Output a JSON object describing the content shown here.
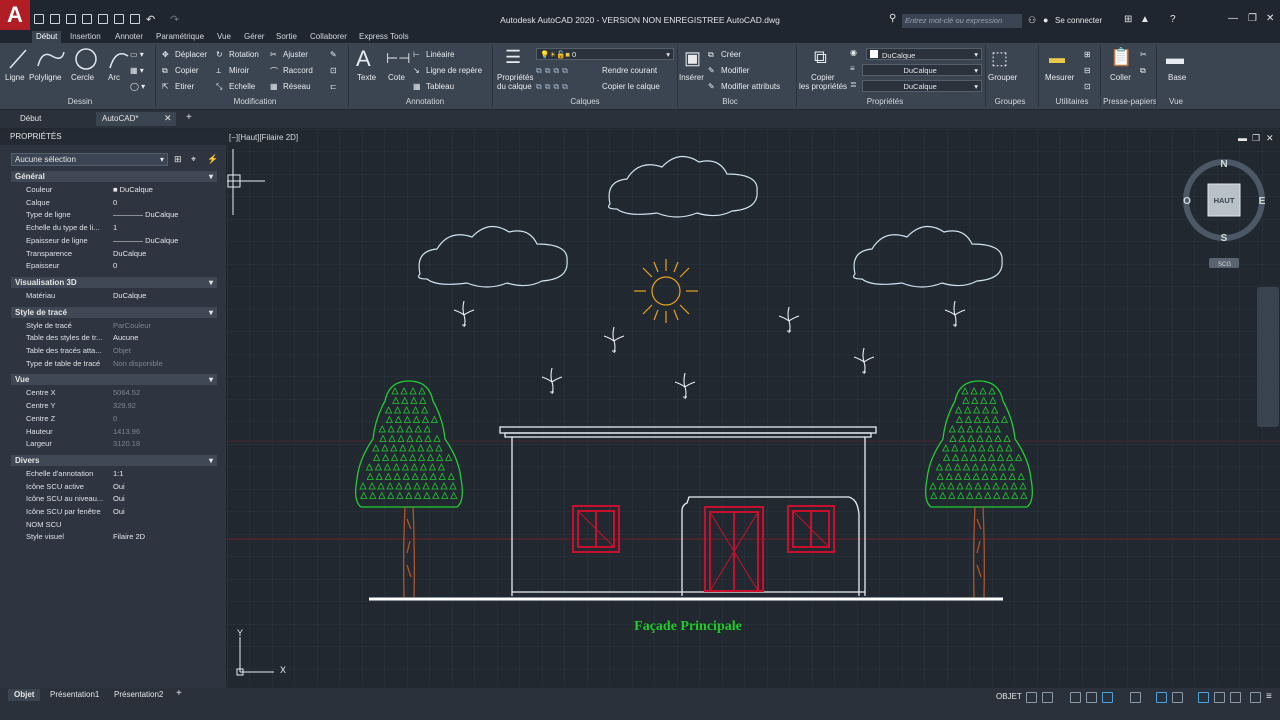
{
  "app": {
    "title": "Autodesk AutoCAD 2020 - VERSION NON ENREGISTREE   AutoCAD.dwg",
    "logo_letter": "A",
    "search_placeholder": "Entrez mot-clé ou expression",
    "signin": "Se connecter"
  },
  "ribbon_tabs": [
    "Début",
    "Insertion",
    "Annoter",
    "Paramétrique",
    "Vue",
    "Gérer",
    "Sortie",
    "Collaborer",
    "Express Tools"
  ],
  "draw": {
    "line": "Ligne",
    "polyline": "Polyligne",
    "circle": "Cercle",
    "arc": "Arc",
    "panel": "Dessin"
  },
  "modify": {
    "move": "Déplacer",
    "rotate": "Rotation",
    "trim": "Ajuster",
    "copy": "Copier",
    "mirror": "Miroir",
    "fillet": "Raccord",
    "stretch": "Etirer",
    "scale": "Echelle",
    "array": "Réseau",
    "panel": "Modification"
  },
  "annotation": {
    "text": "Texte",
    "dim": "Cote",
    "linear": "Linéaire",
    "leader": "Ligne de repère",
    "table": "Tableau",
    "panel": "Annotation"
  },
  "layers": {
    "props1": "Propriétés",
    "props2": "du calque",
    "current": "0",
    "make_current": "Rendre courant",
    "copy_layer": "Copier le calque",
    "panel": "Calques"
  },
  "block": {
    "insert": "Insérer",
    "create": "Créer",
    "edit": "Modifier",
    "edit_attr": "Modifier attributs",
    "panel": "Bloc"
  },
  "properties": {
    "copy1": "Copier",
    "copy2": "les propriétés",
    "color": "DuCalque",
    "linetype": "DuCalque",
    "lineweight": "DuCalque",
    "panel": "Propriétés"
  },
  "groups": {
    "group": "Grouper",
    "panel": "Groupes"
  },
  "utilities": {
    "measure": "Mesurer",
    "panel": "Utilitaires"
  },
  "clipboard": {
    "paste": "Coller",
    "panel": "Presse-papiers"
  },
  "view": {
    "base": "Base",
    "panel": "Vue"
  },
  "doc_tabs": [
    "Début",
    "AutoCAD*"
  ],
  "palette": {
    "title": "PROPRIÉTÉS",
    "selection": "Aucune sélection",
    "sections": [
      {
        "name": "Général",
        "rows": [
          [
            "Couleur",
            "■ DuCalque"
          ],
          [
            "Calque",
            "0"
          ],
          [
            "Type de ligne",
            "———— DuCalque"
          ],
          [
            "Echelle du type de li...",
            "1"
          ],
          [
            "Epaisseur de ligne",
            "———— DuCalque"
          ],
          [
            "Transparence",
            "DuCalque"
          ],
          [
            "Epaisseur",
            "0"
          ]
        ]
      },
      {
        "name": "Visualisation 3D",
        "rows": [
          [
            "Matériau",
            "DuCalque"
          ]
        ]
      },
      {
        "name": "Style de tracé",
        "rows": [
          [
            "Style de tracé",
            "ParCouleur"
          ],
          [
            "Table des styles de tr...",
            "Aucune"
          ],
          [
            "Table des tracés atta...",
            "Objet"
          ],
          [
            "Type de table de tracé",
            "Non disponible"
          ]
        ]
      },
      {
        "name": "Vue",
        "rows": [
          [
            "Centre X",
            "5064.52"
          ],
          [
            "Centre Y",
            "329.92"
          ],
          [
            "Centre Z",
            "0"
          ],
          [
            "Hauteur",
            "1413.96"
          ],
          [
            "Largeur",
            "3120.18"
          ]
        ]
      },
      {
        "name": "Divers",
        "rows": [
          [
            "Echelle d'annotation",
            "1:1"
          ],
          [
            "Icône SCU active",
            "Oui"
          ],
          [
            "Icône SCU au niveau...",
            "Oui"
          ],
          [
            "Icône SCU par fenêtre",
            "Oui"
          ],
          [
            "NOM SCU",
            ""
          ],
          [
            "Style visuel",
            "Filaire 2D"
          ]
        ]
      }
    ]
  },
  "viewport": {
    "label": "[−][Haut][Filaire 2D]",
    "drawing_title": "Façade Principale",
    "viewcube": {
      "top": "HAUT",
      "n": "N",
      "s": "S",
      "e": "E",
      "w": "O",
      "ucs": "SCG"
    },
    "ucs_x": "X",
    "ucs_y": "Y"
  },
  "layout_tabs": [
    "Objet",
    "Présentation1",
    "Présentation2"
  ],
  "status": {
    "mode": "OBJET"
  },
  "colors": {
    "tree": "#22cc33",
    "trunk": "#b0552a",
    "windows": "#c8102e",
    "outline": "#e8eef4",
    "cloud": "#cfe3f0",
    "sun": "#e8a21e",
    "title": "#1fcc2a"
  }
}
